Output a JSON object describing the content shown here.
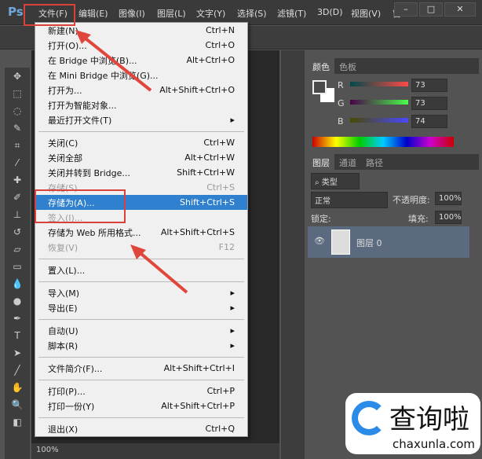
{
  "menubar": {
    "app": "Ps",
    "items": [
      "文件(F)",
      "编辑(E)",
      "图像(I)",
      "图层(L)",
      "文字(Y)",
      "选择(S)",
      "滤镜(T)",
      "3D(D)",
      "视图(V)",
      "窗"
    ],
    "window": [
      "–",
      "□",
      "✕"
    ]
  },
  "file_menu": [
    {
      "label": "新建(N)...",
      "shortcut": "Ctrl+N"
    },
    {
      "label": "打开(O)...",
      "shortcut": "Ctrl+O"
    },
    {
      "label": "在 Bridge 中浏览(B)...",
      "shortcut": "Alt+Ctrl+O"
    },
    {
      "label": "在 Mini Bridge 中浏览(G)...",
      "shortcut": ""
    },
    {
      "label": "打开为...",
      "shortcut": "Alt+Shift+Ctrl+O"
    },
    {
      "label": "打开为智能对象...",
      "shortcut": ""
    },
    {
      "label": "最近打开文件(T)",
      "shortcut": "▸",
      "sep_after": true
    },
    {
      "label": "关闭(C)",
      "shortcut": "Ctrl+W"
    },
    {
      "label": "关闭全部",
      "shortcut": "Alt+Ctrl+W"
    },
    {
      "label": "关闭并转到 Bridge...",
      "shortcut": "Shift+Ctrl+W"
    },
    {
      "label": "存储(S)",
      "shortcut": "Ctrl+S",
      "disabled": true
    },
    {
      "label": "存储为(A)...",
      "shortcut": "Shift+Ctrl+S",
      "highlighted": true
    },
    {
      "label": "签入(I)...",
      "shortcut": "",
      "disabled": true
    },
    {
      "label": "存储为 Web 所用格式...",
      "shortcut": "Alt+Shift+Ctrl+S"
    },
    {
      "label": "恢复(V)",
      "shortcut": "F12",
      "disabled": true,
      "sep_after": true
    },
    {
      "label": "置入(L)...",
      "shortcut": "",
      "sep_after": true
    },
    {
      "label": "导入(M)",
      "shortcut": "▸"
    },
    {
      "label": "导出(E)",
      "shortcut": "▸",
      "sep_after": true
    },
    {
      "label": "自动(U)",
      "shortcut": "▸"
    },
    {
      "label": "脚本(R)",
      "shortcut": "▸",
      "sep_after": true
    },
    {
      "label": "文件简介(F)...",
      "shortcut": "Alt+Shift+Ctrl+I",
      "sep_after": true
    },
    {
      "label": "打印(P)...",
      "shortcut": "Ctrl+P"
    },
    {
      "label": "打印一份(Y)",
      "shortcut": "Alt+Shift+Ctrl+P",
      "sep_after": true
    },
    {
      "label": "退出(X)",
      "shortcut": "Ctrl+Q"
    }
  ],
  "color_panel": {
    "tabs": [
      "颜色",
      "色板"
    ],
    "R": {
      "label": "R",
      "value": "73"
    },
    "G": {
      "label": "G",
      "value": "73"
    },
    "B": {
      "label": "B",
      "value": "74"
    }
  },
  "layers_panel": {
    "tabs": [
      "图层",
      "通道",
      "路径"
    ],
    "filter": "类型",
    "blend": "正常",
    "opacity_label": "不透明度:",
    "opacity": "100%",
    "lock_label": "锁定:",
    "fill_label": "填充:",
    "fill": "100%",
    "layer_name": "图层 0"
  },
  "status": {
    "zoom": "100%"
  },
  "watermark": {
    "text": "查询啦",
    "url": "chaxunla.com"
  },
  "colors": {
    "highlight": "#2f80cf",
    "annotation": "#d9413a"
  }
}
